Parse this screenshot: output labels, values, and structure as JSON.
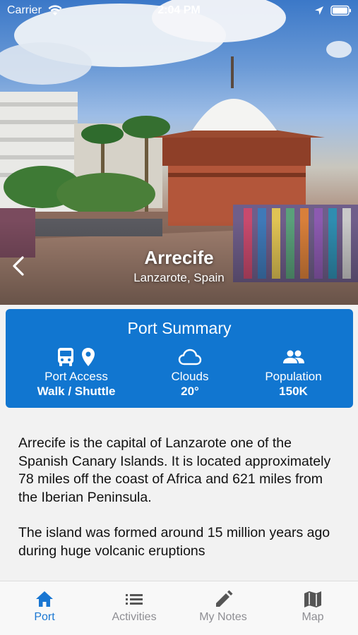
{
  "status_bar": {
    "carrier": "Carrier",
    "time": "2:04 PM"
  },
  "hero": {
    "title": "Arrecife",
    "subtitle": "Lanzarote, Spain"
  },
  "summary": {
    "title": "Port Summary",
    "port_access": {
      "label": "Port Access",
      "value": "Walk / Shuttle",
      "icons": [
        "bus-icon",
        "map-pin-icon"
      ]
    },
    "weather": {
      "label": "Clouds",
      "value": "20°",
      "icon": "cloud-icon"
    },
    "population": {
      "label": "Population",
      "value": "150K",
      "icon": "people-icon"
    }
  },
  "description": {
    "paragraphs": [
      "Arrecife is the capital of Lanzarote one of the Spanish Canary Islands. It is located approximately 78 miles off the coast of Africa and 621 miles from the Iberian Peninsula.",
      "The island was formed around 15 million years ago during huge volcanic eruptions"
    ]
  },
  "tabs": [
    {
      "label": "Port",
      "icon": "home-icon",
      "active": true
    },
    {
      "label": "Activities",
      "icon": "list-icon",
      "active": false
    },
    {
      "label": "My Notes",
      "icon": "pencil-icon",
      "active": false
    },
    {
      "label": "Map",
      "icon": "map-icon",
      "active": false
    }
  ],
  "colors": {
    "accent": "#1176d0",
    "tab_active": "#1976d2",
    "tab_inactive": "#8e8e93"
  }
}
